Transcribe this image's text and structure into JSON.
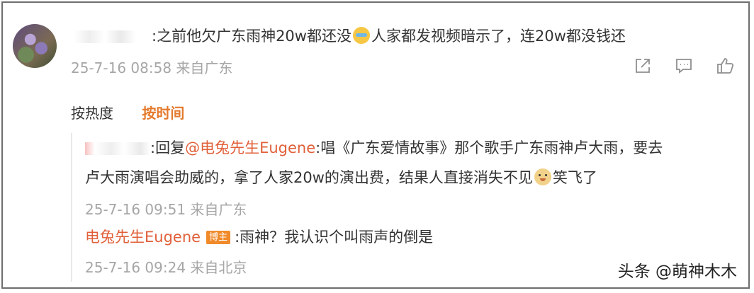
{
  "comment": {
    "text_before_emoji": ":之前他欠广东雨神20w都还没",
    "emoji": "cry-laugh-emoji",
    "text_after_emoji": "人家都发视频暗示了，连20w都没钱还",
    "time": "25-7-16 08:58 来自广东"
  },
  "sort": {
    "hot": "按热度",
    "time": "按时间"
  },
  "replies": [
    {
      "prefix": ":回复",
      "mention": "@电兔先生Eugene",
      "line1_rest": ":唱《广东爱情故事》那个歌手广东雨神卢大雨，要去",
      "line2": "卢大雨演唱会助威的，拿了人家20w的演出费，结果人直接消失不见",
      "emoji": "doge-emoji",
      "line2_end": "笑飞了",
      "time": "25-7-16 09:51 来自广东"
    },
    {
      "user": "电兔先生Eugene",
      "badge": "博主",
      "text": ":雨神？我认识个叫雨声的倒是",
      "time": "25-7-16 09:24 来自北京"
    }
  ],
  "watermark": "头条 @萌神木木",
  "colors": {
    "accent": "#e47a2e",
    "link": "#e0603a",
    "meta": "#a6a6a6",
    "badge": "#f08a2a"
  }
}
